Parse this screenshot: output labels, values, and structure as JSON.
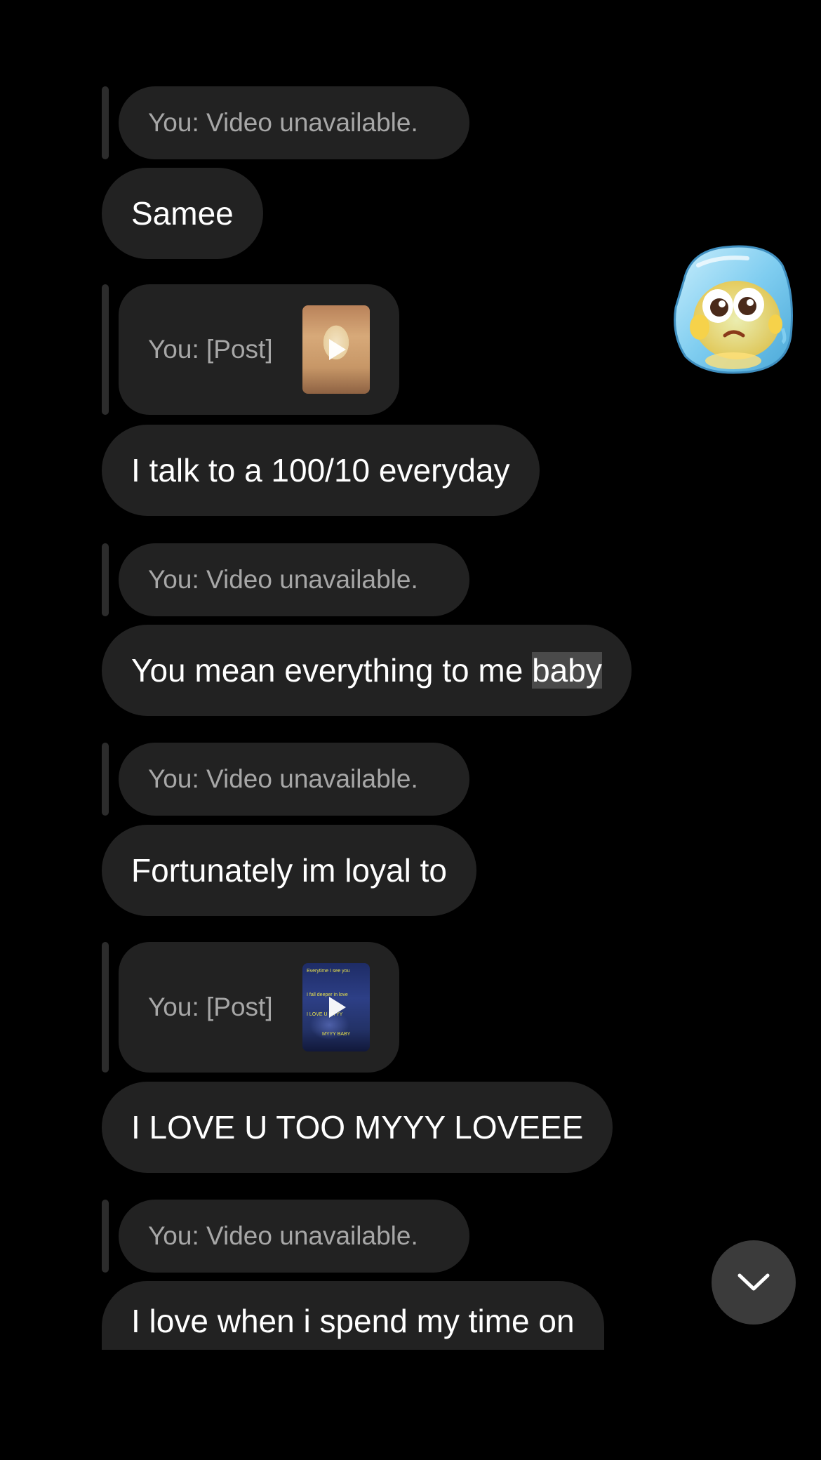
{
  "conversation": {
    "items": [
      {
        "kind": "reply",
        "text": "You: Video unavailable."
      },
      {
        "kind": "message",
        "text": "Samee"
      },
      {
        "kind": "reply_post",
        "text": "You: [Post]",
        "thumbnail": "anime-girl-video-thumbnail"
      },
      {
        "kind": "message",
        "text": "I talk to a 100/10 everyday"
      },
      {
        "kind": "reply",
        "text": "You: Video unavailable."
      },
      {
        "kind": "message",
        "text_before": "You mean everything to me ",
        "text_highlight": "baby"
      },
      {
        "kind": "reply",
        "text": "You: Video unavailable."
      },
      {
        "kind": "message",
        "text": "Fortunately im loyal to"
      },
      {
        "kind": "reply_post",
        "text": "You: [Post]",
        "thumbnail": "blue-scene-video-thumbnail",
        "thumbnail_text": [
          "Everytime I see you",
          "I fall deeper in love",
          "I LOVE U MYYY",
          "MYYY BABY"
        ]
      },
      {
        "kind": "message",
        "text": "I LOVE U TOO MYYY LOVEEE"
      },
      {
        "kind": "reply",
        "text": "You: Video unavailable."
      },
      {
        "kind": "message",
        "text": "I love when i spend my time on"
      }
    ]
  },
  "sticker": {
    "icon": "crying-ice-cube-sticker"
  },
  "scroll_down_button": {
    "icon": "chevron-down-icon"
  },
  "colors": {
    "background": "#000000",
    "bubble": "#222222",
    "reply_text": "#a7a7a7",
    "message_text": "#ffffff",
    "reply_bar": "#2c2c2c",
    "highlight": "#4a4a4a",
    "scroll_button": "#3b3b3b"
  }
}
